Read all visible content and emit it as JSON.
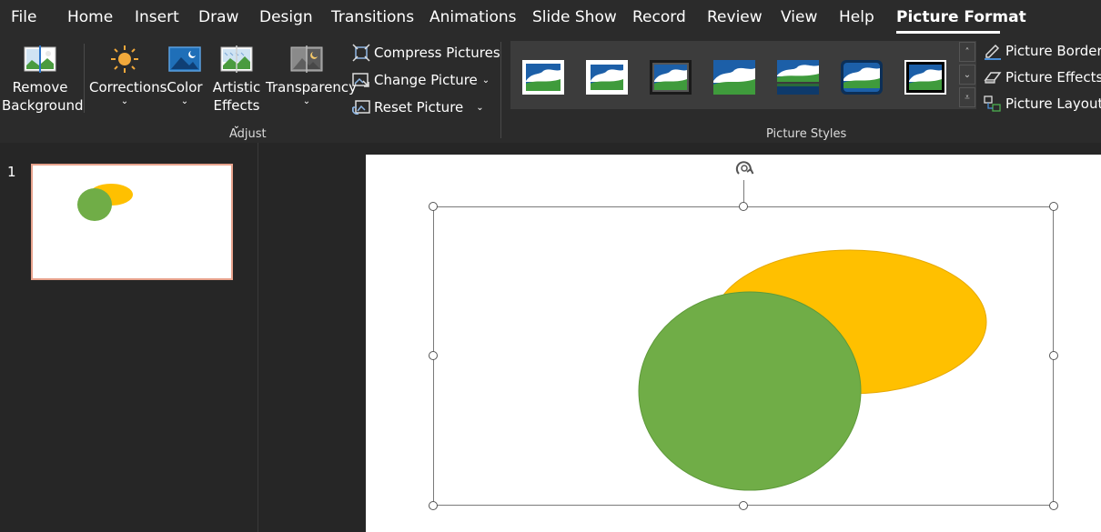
{
  "menu": {
    "tabs": [
      {
        "label": "File"
      },
      {
        "label": "Home"
      },
      {
        "label": "Insert"
      },
      {
        "label": "Draw"
      },
      {
        "label": "Design"
      },
      {
        "label": "Transitions"
      },
      {
        "label": "Animations"
      },
      {
        "label": "Slide Show"
      },
      {
        "label": "Record"
      },
      {
        "label": "Review"
      },
      {
        "label": "View"
      },
      {
        "label": "Help"
      },
      {
        "label": "Picture Format"
      }
    ],
    "active_tab": "Picture Format"
  },
  "ribbon": {
    "adjust": {
      "remove_background": {
        "line1": "Remove",
        "line2": "Background"
      },
      "corrections": {
        "label": "Corrections"
      },
      "color": {
        "label": "Color"
      },
      "artistic_effects": {
        "line1": "Artistic",
        "line2": "Effects"
      },
      "transparency": {
        "label": "Transparency"
      },
      "compress_pictures": "Compress Pictures",
      "change_picture": "Change Picture",
      "reset_picture": "Reset Picture",
      "group_label": "Adjust"
    },
    "picture_styles": {
      "group_label": "Picture Styles",
      "picture_border": "Picture Border",
      "picture_effects": "Picture Effects",
      "picture_layout": "Picture Layout"
    }
  },
  "slides_pane": {
    "slides": [
      {
        "number": "1"
      }
    ]
  },
  "colors": {
    "green_ellipse": "#70ad47",
    "yellow_ellipse": "#ffc000",
    "thumb_border": "#e8a38d"
  }
}
